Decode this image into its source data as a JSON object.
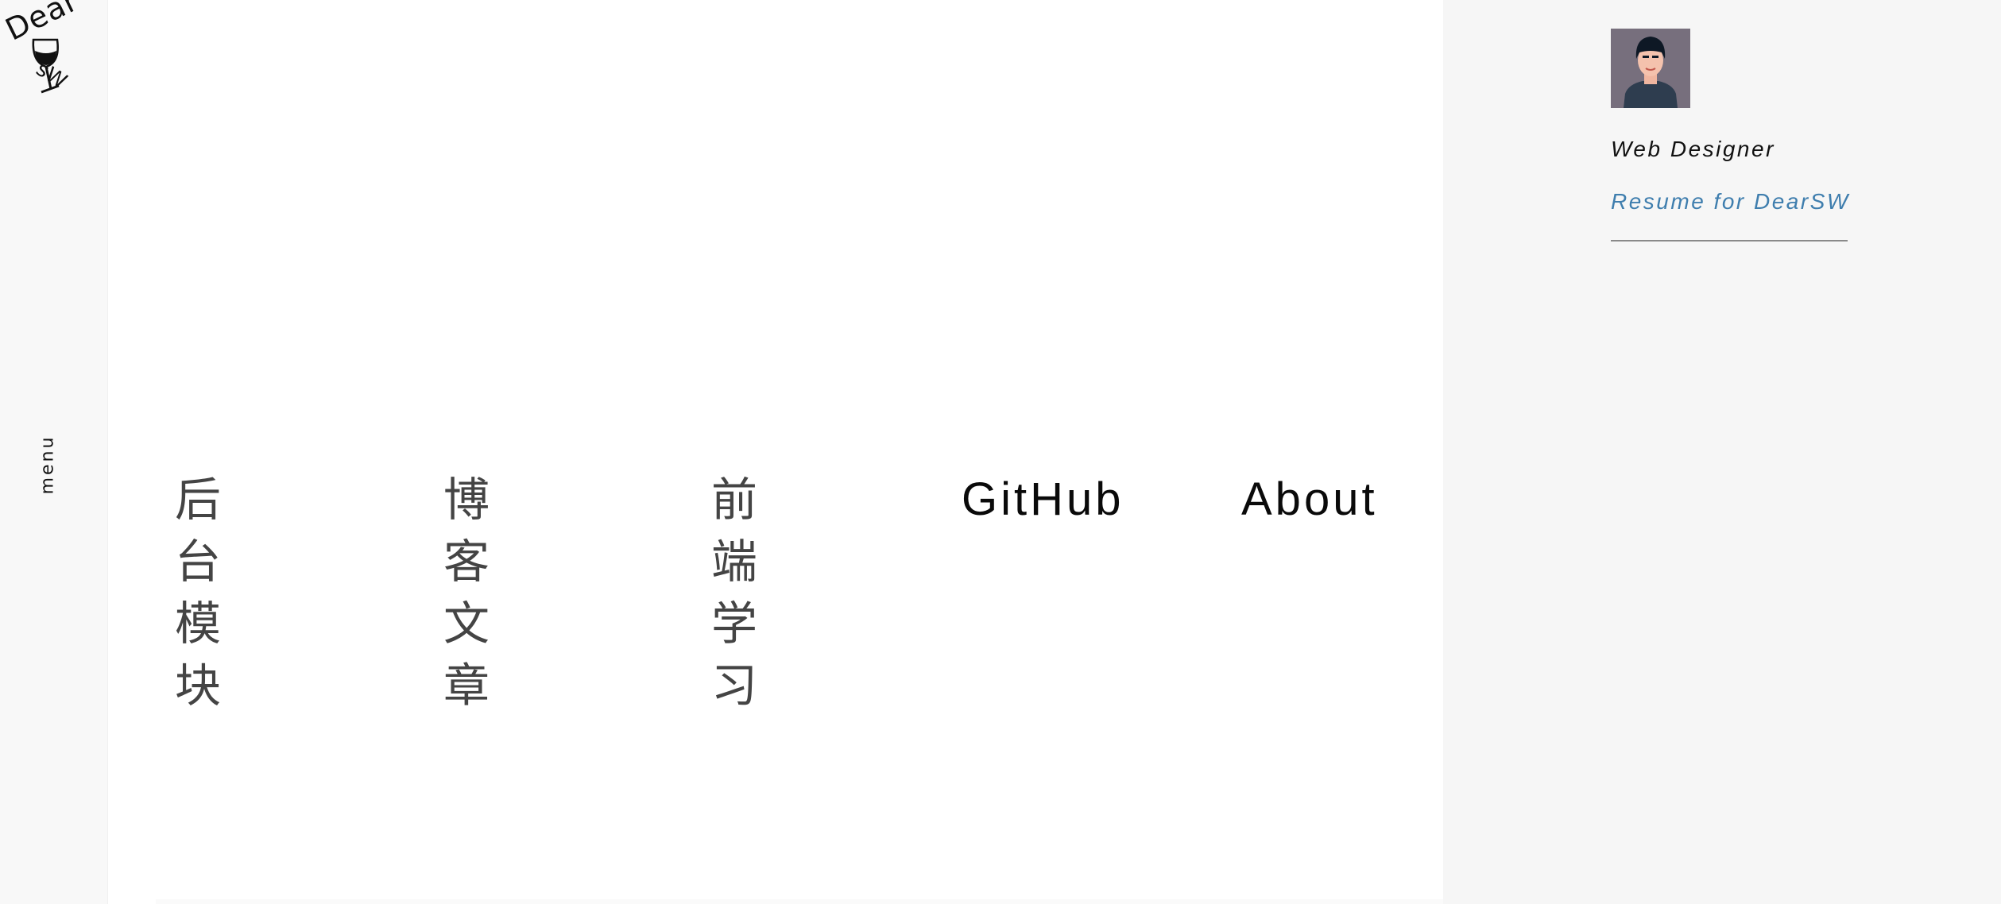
{
  "logo": {
    "line1": "Dear",
    "line2": "sW",
    "icon": "wine-glass-icon"
  },
  "menu": {
    "label": "menu"
  },
  "nav": {
    "items": [
      {
        "label": "后台模块"
      },
      {
        "label": "博客文章"
      },
      {
        "label": "前端学习"
      },
      {
        "label": "GitHub"
      },
      {
        "label": "About"
      }
    ]
  },
  "profile": {
    "avatar_icon": "avatar-illustration",
    "role": "Web Designer",
    "resume_link": "Resume for DearSW"
  },
  "colors": {
    "link": "#3f7eae",
    "rail_bg": "#f8f8f8",
    "panel_bg": "#f6f6f6",
    "avatar_bg": "#776f7d"
  }
}
